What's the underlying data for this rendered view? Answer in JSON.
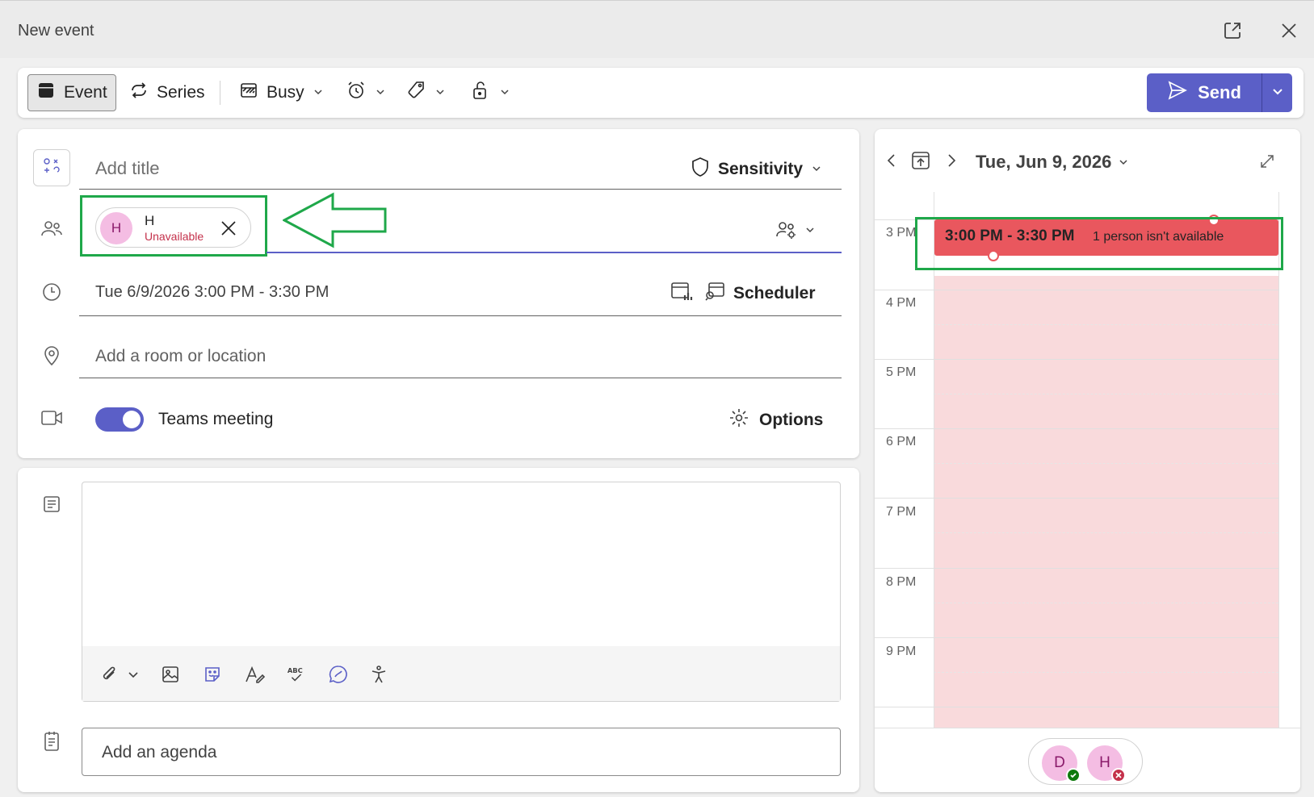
{
  "window": {
    "title": "New event"
  },
  "toolbar": {
    "event_label": "Event",
    "series_label": "Series",
    "busy_label": "Busy",
    "send_label": "Send"
  },
  "form": {
    "title_placeholder": "Add title",
    "sensitivity_label": "Sensitivity",
    "attendee": {
      "initial": "H",
      "name": "H",
      "status": "Unavailable"
    },
    "datetime": "Tue 6/9/2026 3:00 PM - 3:30 PM",
    "scheduler_label": "Scheduler",
    "location_placeholder": "Add a room or location",
    "teams_meeting_label": "Teams meeting",
    "teams_meeting_on": true,
    "options_label": "Options",
    "agenda_placeholder": "Add an agenda"
  },
  "calendar": {
    "date_label": "Tue, Jun 9, 2026",
    "hours": [
      "3 PM",
      "4 PM",
      "5 PM",
      "6 PM",
      "7 PM",
      "8 PM",
      "9 PM"
    ],
    "event_time": "3:00 PM - 3:30 PM",
    "event_status": "1 person isn't available",
    "participants": [
      {
        "initial": "D",
        "status": "accepted"
      },
      {
        "initial": "H",
        "status": "unavailable"
      }
    ]
  },
  "colors": {
    "accent": "#5b5fc7",
    "conflict": "#e9575e",
    "busy_fill": "#f9dadc",
    "highlight": "#1fa84a",
    "unavailable_text": "#c4314b"
  }
}
